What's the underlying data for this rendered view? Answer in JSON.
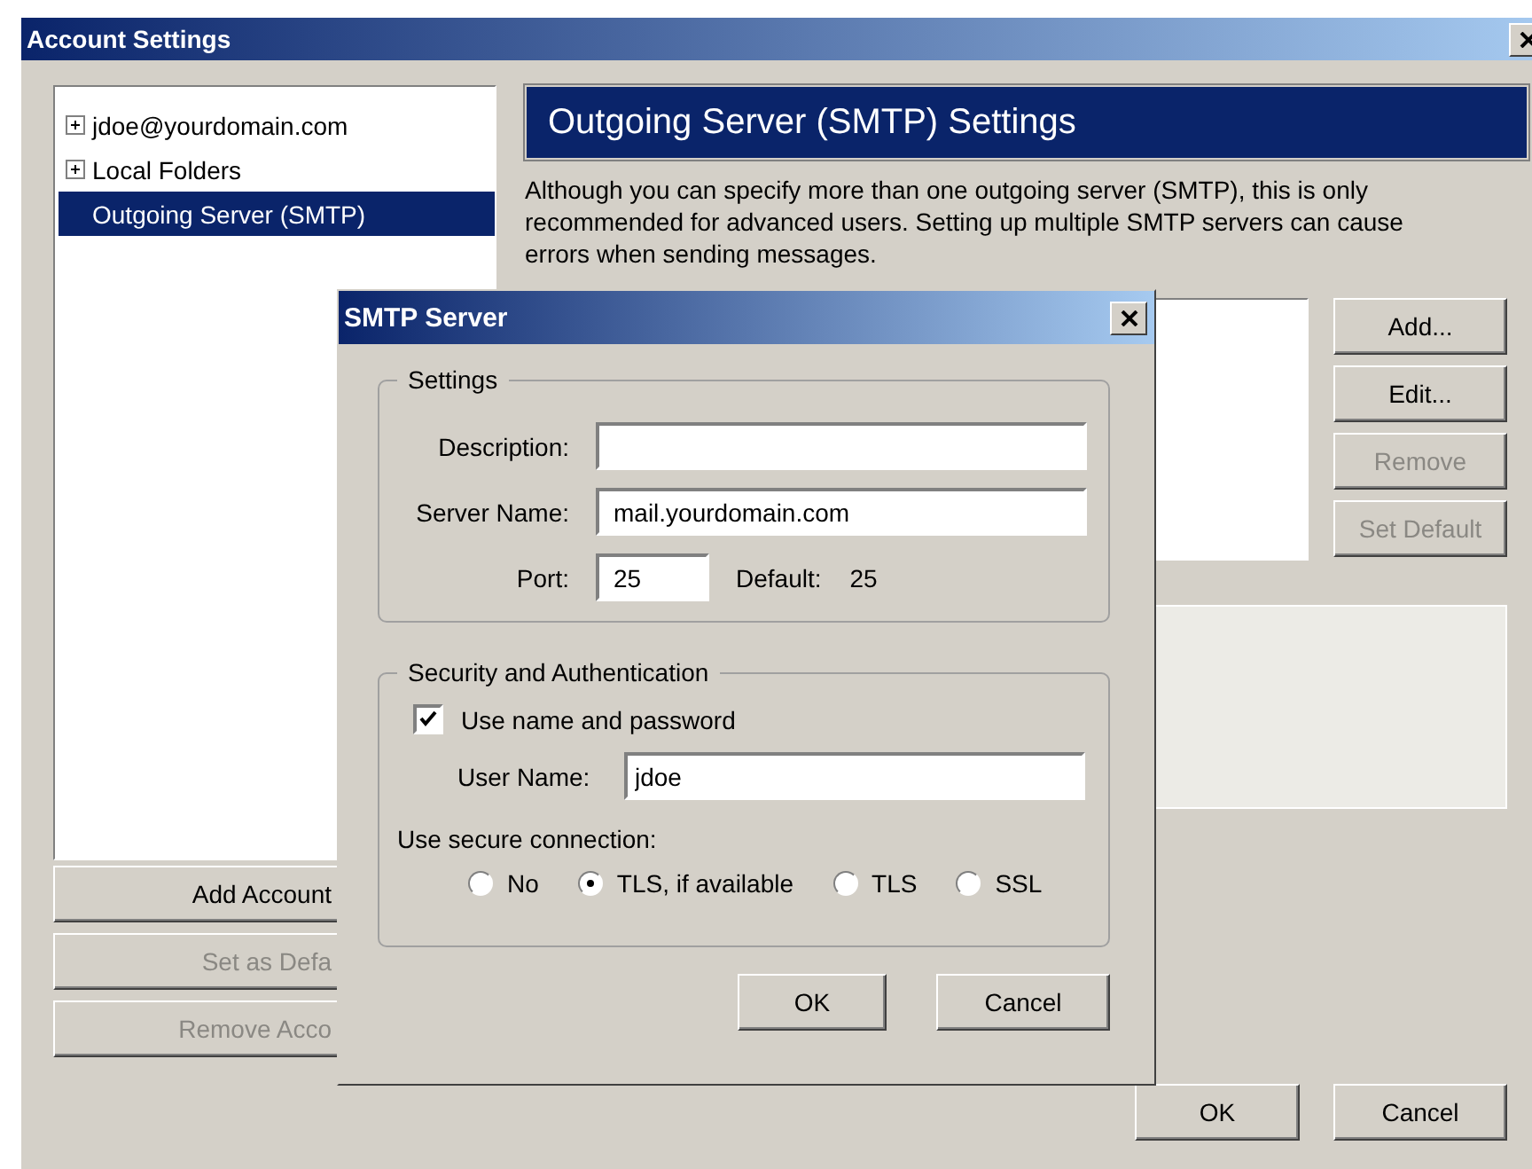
{
  "window": {
    "title": "Account Settings"
  },
  "sidebar": {
    "items": [
      {
        "label": "jdoe@yourdomain.com",
        "expandable": true,
        "selected": false
      },
      {
        "label": "Local Folders",
        "expandable": true,
        "selected": false
      },
      {
        "label": "Outgoing Server (SMTP)",
        "expandable": false,
        "selected": true
      }
    ]
  },
  "account_buttons": [
    {
      "label": "Add Account",
      "disabled": false
    },
    {
      "label": "Set as Defa",
      "disabled": true
    },
    {
      "label": "Remove Acco",
      "disabled": true
    }
  ],
  "panel": {
    "heading": "Outgoing Server (SMTP) Settings",
    "description": "Although you can specify more than one outgoing server (SMTP), this is only recommended for advanced users. Setting up multiple SMTP servers can cause errors when sending messages.",
    "server_buttons": [
      {
        "label": "Add...",
        "disabled": false
      },
      {
        "label": "Edit...",
        "disabled": false
      },
      {
        "label": "Remove",
        "disabled": true
      },
      {
        "label": "Set Default",
        "disabled": true
      }
    ]
  },
  "footer_buttons": [
    "OK",
    "Cancel"
  ],
  "dialog": {
    "title": "SMTP Server",
    "settings": {
      "legend": "Settings",
      "fields": [
        {
          "label": "Description:"
        },
        {
          "label": "Server Name:",
          "value": "mail.yourdomain.com"
        }
      ],
      "port": {
        "label": "Port:",
        "value": "25",
        "default_label": "Default:",
        "default_value": "25"
      }
    },
    "security": {
      "legend": "Security and Authentication",
      "use_name": {
        "label": "Use name and password",
        "checked": true
      },
      "user_name": {
        "label": "User Name:",
        "value": "jdoe"
      },
      "secure_label": "Use secure connection:",
      "options": [
        {
          "label": "No",
          "selected": false
        },
        {
          "label": "TLS, if available",
          "selected": true
        },
        {
          "label": "TLS",
          "selected": false
        },
        {
          "label": "SSL",
          "selected": false
        }
      ]
    },
    "buttons": [
      "OK",
      "Cancel"
    ]
  }
}
